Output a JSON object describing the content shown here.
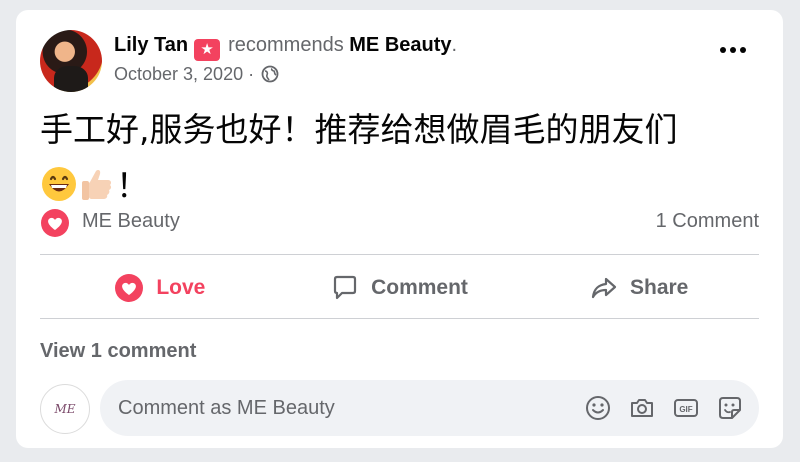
{
  "post": {
    "author": "Lily Tan",
    "recommends_text": "recommends",
    "page_name": "ME Beauty",
    "page_suffix": ".",
    "date": "October 3, 2020",
    "date_separator": "·",
    "body": "手工好,服务也好！推荐给想做眉毛的朋友们",
    "body_end": "！"
  },
  "reactions": {
    "reactor": "ME Beauty",
    "comment_count": "1 Comment"
  },
  "actions": {
    "love": "Love",
    "comment": "Comment",
    "share": "Share"
  },
  "comments": {
    "view_label": "View 1 comment",
    "input_placeholder": "Comment as ME Beauty",
    "page_avatar_text": "ME"
  },
  "colors": {
    "love": "#f3425f",
    "muted": "#65676b",
    "text": "#050505"
  },
  "icons": [
    "recommend-star-icon",
    "globe-icon",
    "more-icon",
    "grinning-emoji",
    "thumbs-up-emoji",
    "heart-icon",
    "comment-icon",
    "share-icon",
    "smiley-icon",
    "camera-icon",
    "gif-icon",
    "sticker-icon"
  ]
}
